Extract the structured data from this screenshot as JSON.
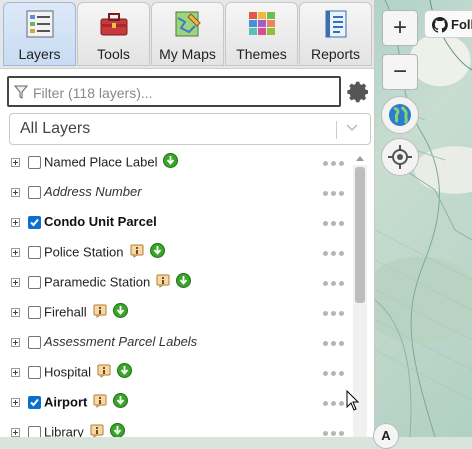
{
  "tabs": [
    {
      "label": "Layers",
      "icon": "layers-icon",
      "active": true
    },
    {
      "label": "Tools",
      "icon": "toolbox-icon",
      "active": false
    },
    {
      "label": "My Maps",
      "icon": "map-pencil-icon",
      "active": false
    },
    {
      "label": "Themes",
      "icon": "themes-grid-icon",
      "active": false
    },
    {
      "label": "Reports",
      "icon": "report-icon",
      "active": false
    }
  ],
  "filter": {
    "placeholder": "Filter (118 layers)...",
    "value": ""
  },
  "layer_group_select": {
    "selected": "All Layers"
  },
  "layers": [
    {
      "name": "Named Place Label",
      "checked": false,
      "style": "normal",
      "info_badge": false,
      "download_badge": true
    },
    {
      "name": "Address Number",
      "checked": false,
      "style": "italic",
      "info_badge": false,
      "download_badge": false
    },
    {
      "name": "Condo Unit Parcel",
      "checked": true,
      "style": "bold",
      "info_badge": false,
      "download_badge": false
    },
    {
      "name": "Police Station",
      "checked": false,
      "style": "normal",
      "info_badge": true,
      "download_badge": true
    },
    {
      "name": "Paramedic Station",
      "checked": false,
      "style": "normal",
      "info_badge": true,
      "download_badge": true
    },
    {
      "name": "Firehall",
      "checked": false,
      "style": "normal",
      "info_badge": true,
      "download_badge": true
    },
    {
      "name": "Assessment Parcel Labels",
      "checked": false,
      "style": "italic",
      "info_badge": false,
      "download_badge": false
    },
    {
      "name": "Hospital",
      "checked": false,
      "style": "normal",
      "info_badge": true,
      "download_badge": true
    },
    {
      "name": "Airport",
      "checked": true,
      "style": "bold",
      "info_badge": true,
      "download_badge": true
    },
    {
      "name": "Library",
      "checked": false,
      "style": "normal",
      "info_badge": true,
      "download_badge": true
    }
  ],
  "map_controls": {
    "zoom_in": "+",
    "zoom_out": "−",
    "github_label": "Foll",
    "attribution_label": "A"
  },
  "colors": {
    "accent": "#0b6fd0",
    "download_green": "#3aa629",
    "info_orange": "#d9892b"
  }
}
